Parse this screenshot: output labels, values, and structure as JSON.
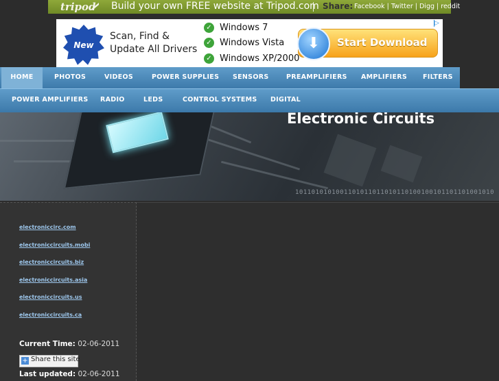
{
  "tripod": {
    "logo": "tripod",
    "tagline": "Build your own FREE website at Tripod.com",
    "share_label": "Share:",
    "share_links": [
      "Facebook",
      "Twitter",
      "Digg",
      "reddit"
    ]
  },
  "ad": {
    "badge": "New",
    "headline": "Scan, Find & Update All Drivers",
    "bullets": [
      "Windows 7",
      "Windows Vista",
      "Windows XP/2000"
    ],
    "button_label": "Start Download",
    "choices_icon": "ad-choices-icon"
  },
  "nav": {
    "row1": [
      "HOME",
      "PHOTOS",
      "VIDEOS",
      "POWER SUPPLIES",
      "SENSORS",
      "PREAMPLIFIERS",
      "AMPLIFIERS",
      "FILTERS"
    ],
    "row2": [
      "POWER AMPLIFIERS",
      "RADIO",
      "LEDS",
      "CONTROL SYSTEMS",
      "DIGITAL"
    ],
    "active": "HOME"
  },
  "banner": {
    "title": "Electronic Circuits",
    "binary": "1011010101001101011011010110100100101101101001010"
  },
  "sidebar": {
    "links": [
      "electroniccirc.com",
      "electroniccircuits.mobi",
      "electroniccircuits.biz",
      "electroniccircuits.asia",
      "electroniccircuits.us",
      "electroniccircuits.ca"
    ],
    "current_time_label": "Current Time:",
    "current_time_value": "02-06-2011",
    "share_button": "Share this site",
    "last_updated_label": "Last updated:",
    "last_updated_value": "02-06-2011"
  },
  "colors": {
    "tripod_bar": "#7f9a2e",
    "nav": "#4b88b9",
    "nav_active": "#7fb2d7",
    "page_bg": "#2c2c2c",
    "link": "#9ec8ee"
  }
}
